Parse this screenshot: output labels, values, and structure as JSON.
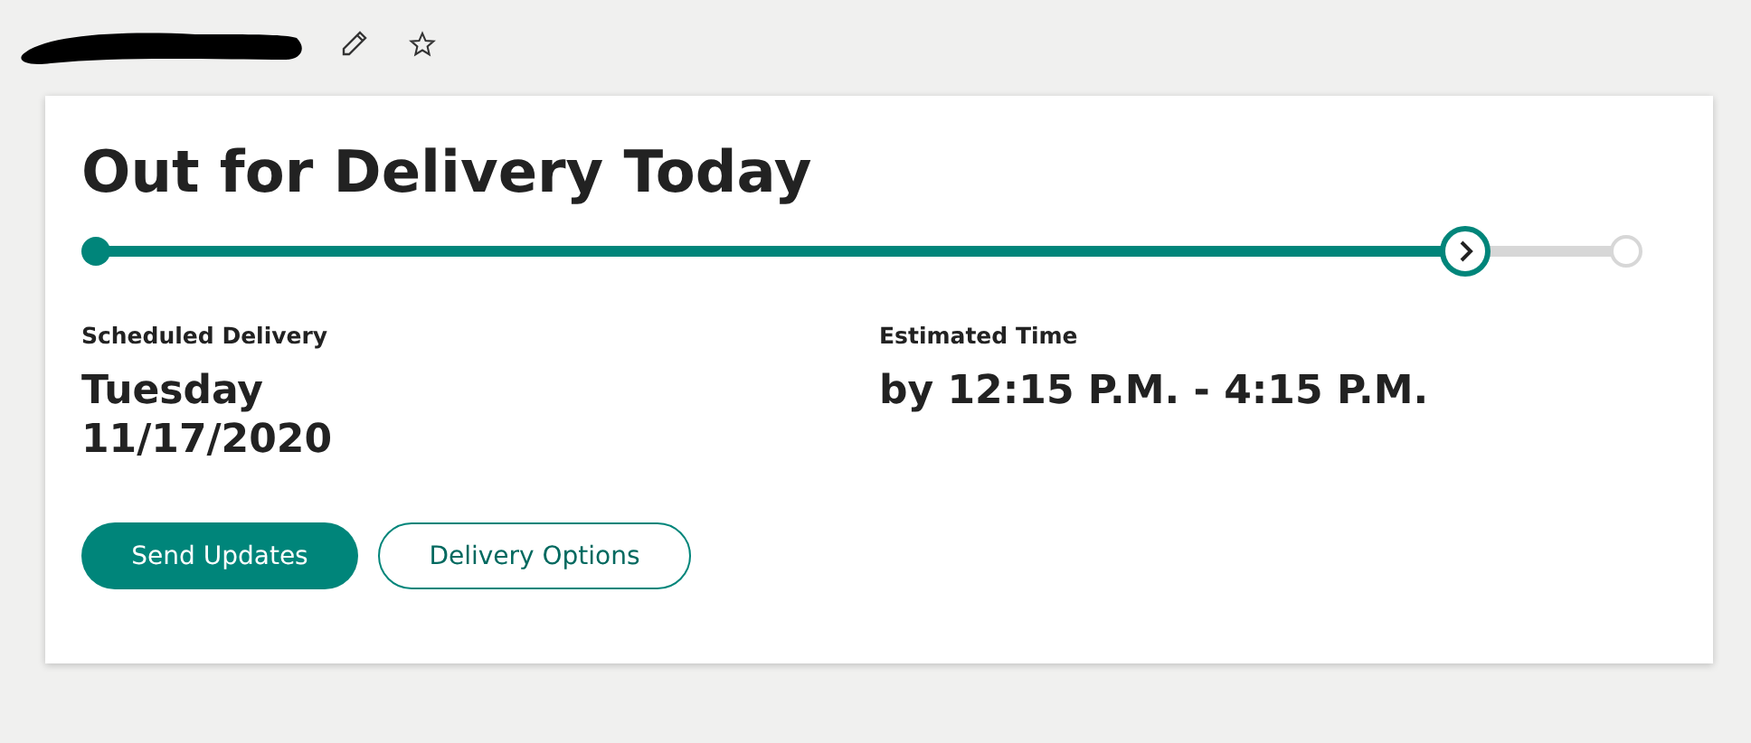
{
  "status": {
    "title": "Out for Delivery Today",
    "progress": {
      "level": 0.895
    }
  },
  "details": [
    {
      "label": "Scheduled Delivery",
      "value_lines": [
        "Tuesday",
        "11/17/2020"
      ]
    },
    {
      "label": "Estimated Time",
      "value_lines": [
        "by 12:15 P.M. - 4:15 P.M."
      ]
    }
  ],
  "buttons": [
    {
      "label": "Send Updates",
      "kind": "primary"
    },
    {
      "label": "Delivery Options",
      "kind": "secondary"
    }
  ]
}
